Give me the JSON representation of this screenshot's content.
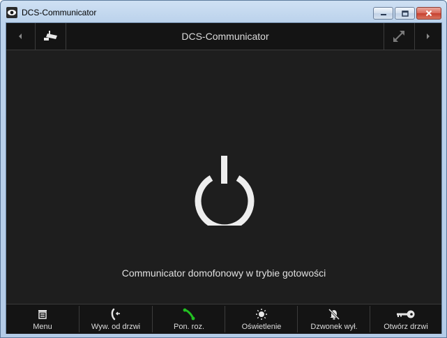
{
  "window": {
    "title": "DCS-Communicator"
  },
  "header": {
    "title": "DCS-Communicator"
  },
  "status": {
    "message": "Communicator domofonowy w trybie gotowości"
  },
  "bottom_bar": [
    {
      "label": "Menu",
      "icon": "menu-icon"
    },
    {
      "label": "Wyw. od drzwi",
      "icon": "handset-call-icon"
    },
    {
      "label": "Pon. roz.",
      "icon": "handset-green-icon"
    },
    {
      "label": "Oświetlenie",
      "icon": "light-icon"
    },
    {
      "label": "Dzwonek wył.",
      "icon": "bell-off-icon"
    },
    {
      "label": "Otwórz drzwi",
      "icon": "key-icon"
    }
  ],
  "colors": {
    "background": "#1e1e1e",
    "bar": "#141414",
    "text": "#dcdcdc",
    "accent_green": "#22c022"
  }
}
